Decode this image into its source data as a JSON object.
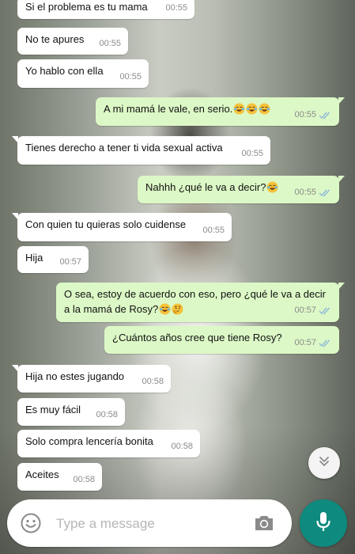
{
  "colors": {
    "incoming_bubble": "#ffffff",
    "outgoing_bubble": "#dcf8c6",
    "read_ticks": "#8fb9d9",
    "accent": "#0f8a7e"
  },
  "messages": [
    {
      "text": "Si el problema es tu mama",
      "time": "00:55",
      "direction": "in"
    },
    {
      "text": "No te apures",
      "time": "00:55",
      "direction": "in"
    },
    {
      "text": "Yo hablo con ella",
      "time": "00:55",
      "direction": "in"
    },
    {
      "text": "A mi mamá le vale, en serio.",
      "emoji": [
        "tears-of-joy",
        "tears-of-joy",
        "tears-of-joy"
      ],
      "time": "00:55",
      "direction": "out",
      "status": "read"
    },
    {
      "text": "Tienes derecho a tener ti vida sexual activa",
      "time": "00:55",
      "direction": "in"
    },
    {
      "text": "Nahhh ¿qué le va a decir?",
      "emoji": [
        "tears-of-joy"
      ],
      "time": "00:55",
      "direction": "out",
      "status": "read"
    },
    {
      "text": "Con quien tu quieras solo cuidense",
      "time": "00:55",
      "direction": "in"
    },
    {
      "text": "Hija",
      "time": "00:57",
      "direction": "in"
    },
    {
      "text_line1": "O sea, estoy de acuerdo con eso, pero ¿qué le va a decir",
      "text_line2": "a la mamá de Rosy?",
      "emoji": [
        "tears-of-joy",
        "thinking-face"
      ],
      "time": "00:57",
      "direction": "out",
      "status": "read"
    },
    {
      "text": "¿Cuántos años cree que tiene Rosy?",
      "time": "00:57",
      "direction": "out",
      "status": "read"
    },
    {
      "text": "Hija no estes jugando",
      "time": "00:58",
      "direction": "in"
    },
    {
      "text": "Es muy fácil",
      "time": "00:58",
      "direction": "in"
    },
    {
      "text": "Solo compra lencería bonita",
      "time": "00:58",
      "direction": "in"
    },
    {
      "text": "Aceites",
      "time": "00:58",
      "direction": "in"
    }
  ],
  "input": {
    "placeholder": "Type a message",
    "value": ""
  },
  "icons": {
    "emoji_button": "smiley-icon",
    "camera_button": "camera-icon",
    "send_button": "microphone-icon",
    "scroll_button": "double-chevron-down-icon"
  }
}
